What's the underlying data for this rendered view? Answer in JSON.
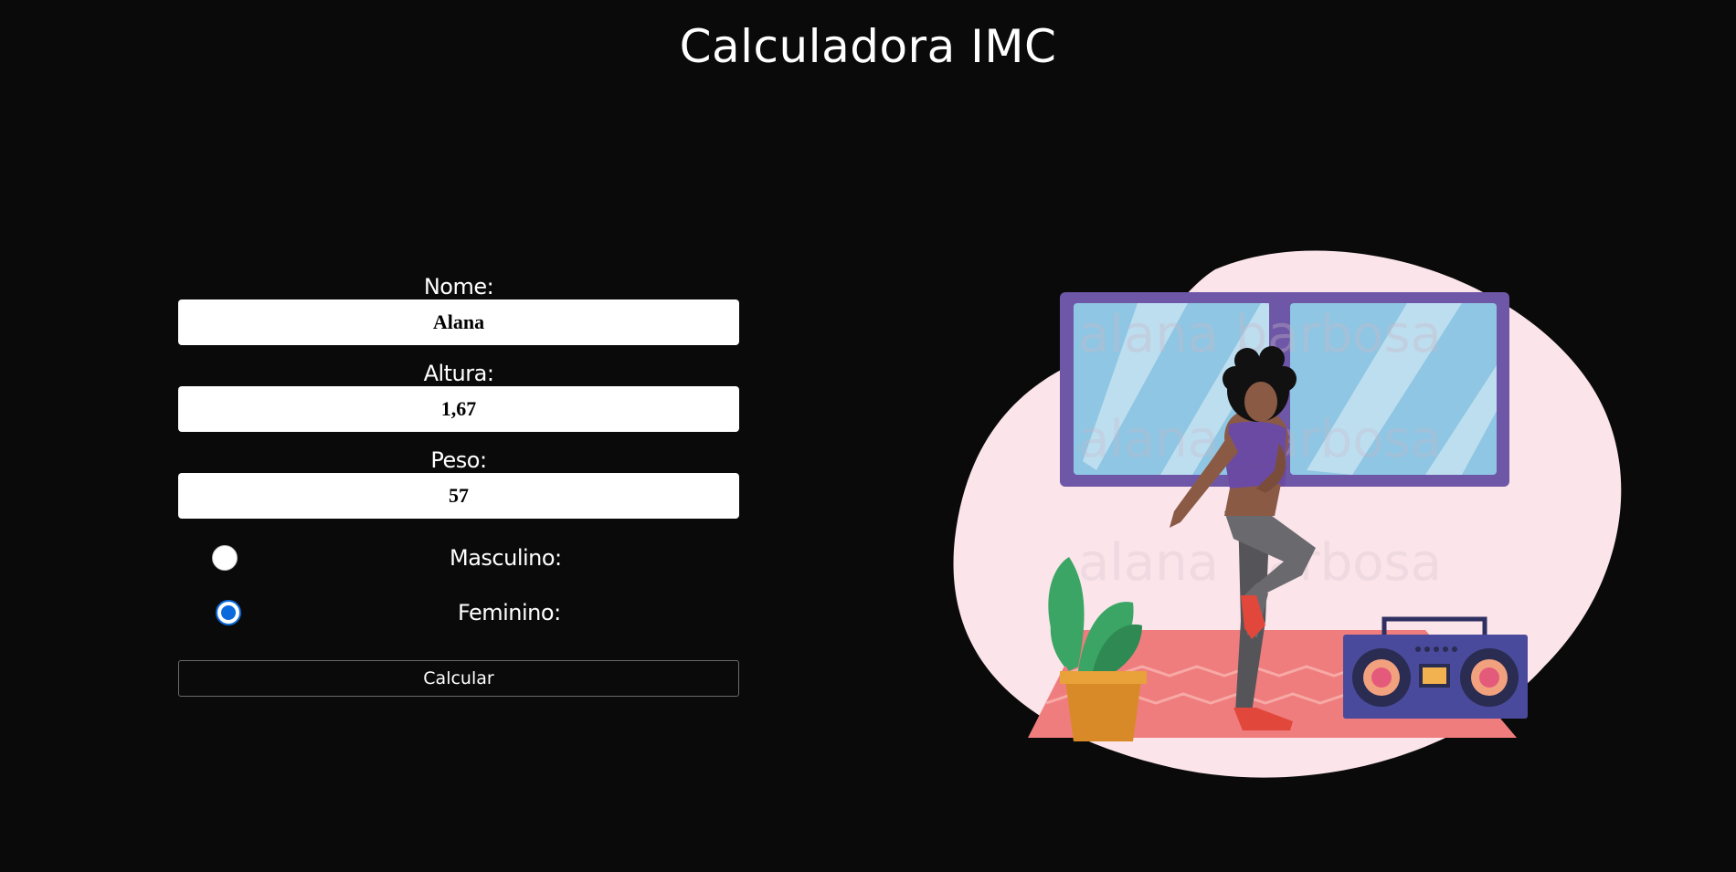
{
  "header": {
    "title": "Calculadora IMC"
  },
  "form": {
    "name_label": "Nome:",
    "name_value": "Alana",
    "height_label": "Altura:",
    "height_value": "1,67",
    "weight_label": "Peso:",
    "weight_value": "57",
    "gender": {
      "male_label": "Masculino:",
      "female_label": "Feminino:",
      "selected": "female"
    },
    "submit_label": "Calcular"
  },
  "illustration": {
    "watermark": "alana barbosa",
    "icon": "workout-woman-illustration"
  },
  "colors": {
    "background": "#0a0a0a",
    "accent_radio": "#0b6bdc",
    "blob": "#fbe4ea",
    "window_frame": "#6e57a6",
    "window_glass": "#8fc6e3",
    "rug": "#ef7d7d",
    "plant": "#3aa564",
    "pot": "#d88a28",
    "boombox": "#4a4a9c"
  }
}
